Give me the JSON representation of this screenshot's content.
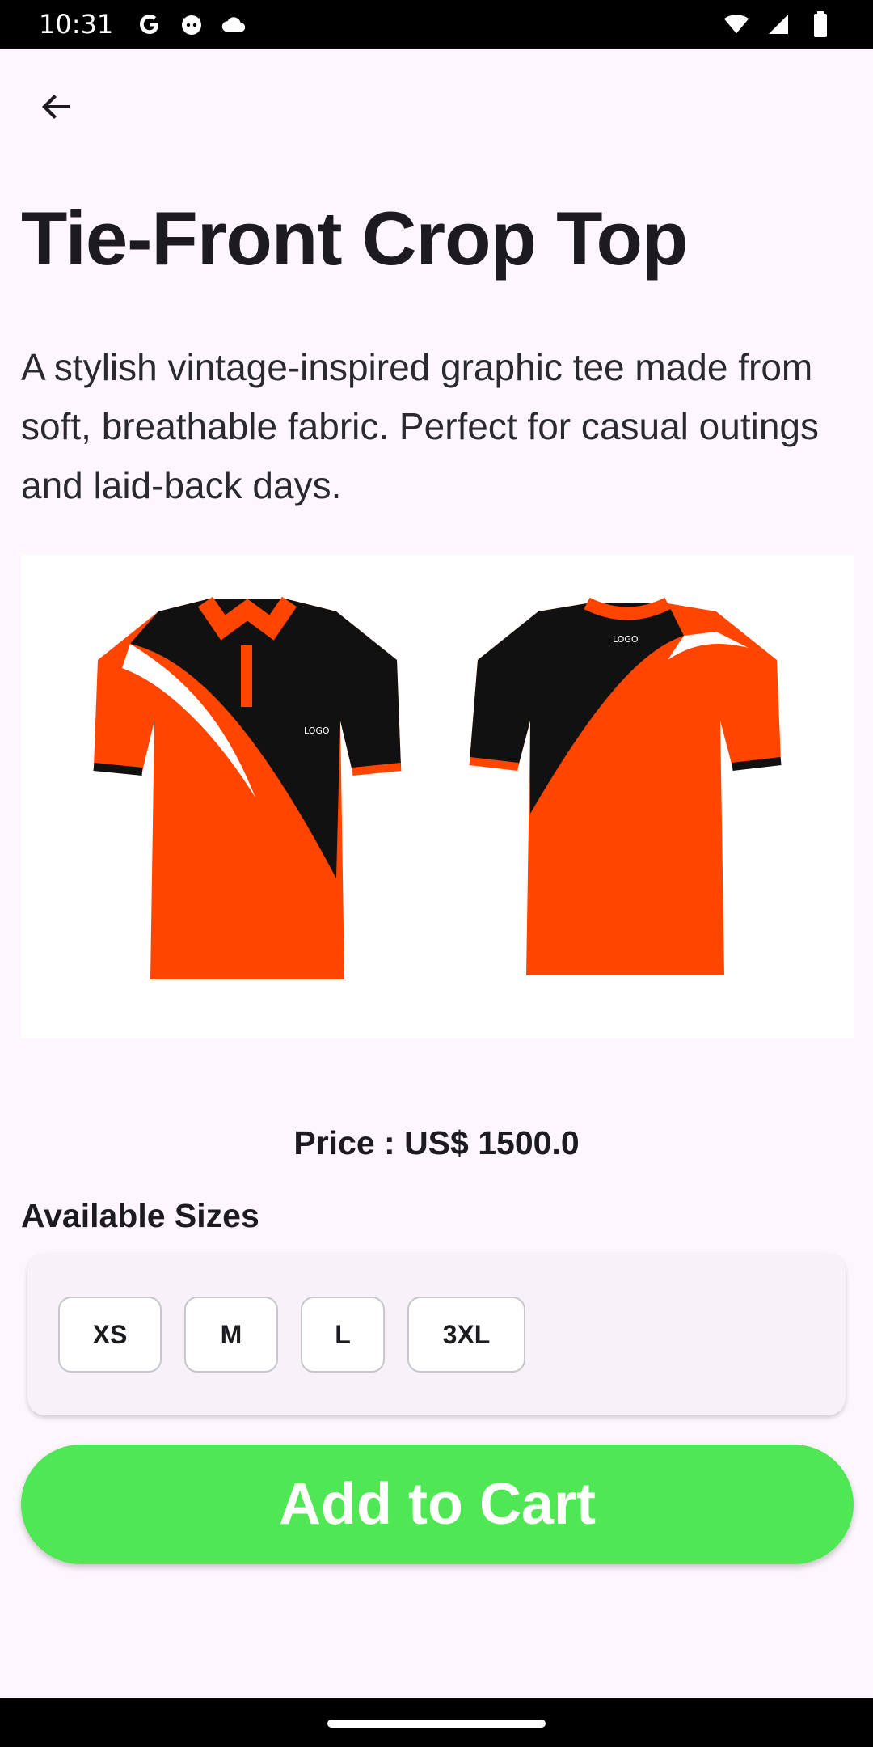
{
  "status_bar": {
    "time": "10:31",
    "left_icons": [
      "google-icon",
      "cat-icon",
      "cloud-icon"
    ],
    "right_icons": [
      "wifi-icon",
      "signal-icon",
      "battery-icon"
    ]
  },
  "product": {
    "title": "Tie-Front Crop Top",
    "description": "A stylish vintage-inspired graphic tee made from soft, breathable fabric. Perfect for casual outings and laid-back days.",
    "price": "Price : US$ 1500.0",
    "image_logo_text": "LOGO",
    "image_colors": {
      "primary": "#ff4500",
      "secondary": "#111111",
      "accent": "#ffffff"
    }
  },
  "sizes": {
    "heading": "Available Sizes",
    "options": [
      "XS",
      "M",
      "L",
      "3XL"
    ]
  },
  "actions": {
    "add_to_cart": "Add to Cart"
  },
  "colors": {
    "background": "#fdf7fd",
    "cart_button": "#4fe854",
    "text": "#1d1b20"
  }
}
